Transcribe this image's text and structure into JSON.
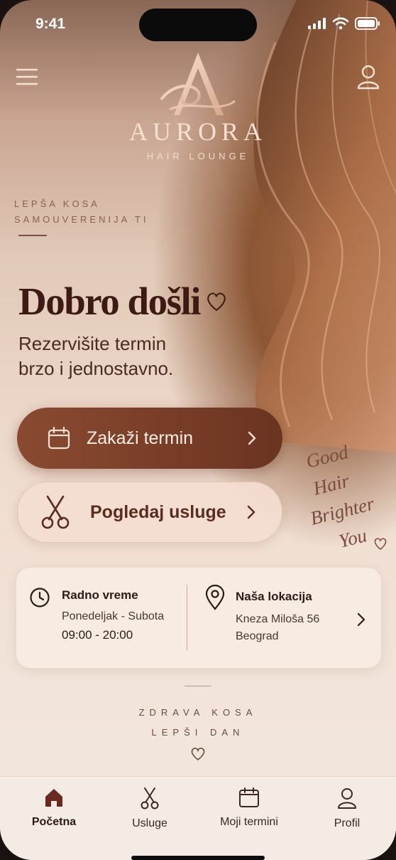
{
  "status": {
    "time": "9:41"
  },
  "brand": {
    "name": "AURORA",
    "sub": "HAIR LOUNGE"
  },
  "tagline": {
    "line1": "LEPŠA KOSA",
    "line2": "SAMOUVERENIJA TI"
  },
  "hero": {
    "title": "Dobro došli",
    "subtitle_line1": "Rezervišite termin",
    "subtitle_line2": "brzo i jednostavno."
  },
  "actions": {
    "book_label": "Zakaži termin",
    "services_label": "Pogledaj usluge"
  },
  "script_text": [
    "Good",
    "Hair",
    "Brighter",
    "You"
  ],
  "info": {
    "hours_title": "Radno vreme",
    "hours_days": "Ponedeljak - Subota",
    "hours_time": "09:00 - 20:00",
    "location_title": "Naša lokacija",
    "location_street": "Kneza Miloša 56",
    "location_city": "Beograd"
  },
  "bottom_tag": {
    "line1": "ZDRAVA KOSA",
    "line2": "LEPŠI DAN"
  },
  "tabs": [
    {
      "label": "Početna",
      "icon": "home-icon"
    },
    {
      "label": "Usluge",
      "icon": "scissors-icon"
    },
    {
      "label": "Moji termini",
      "icon": "calendar-icon"
    },
    {
      "label": "Profil",
      "icon": "user-icon"
    }
  ],
  "colors": {
    "primary": "#7a3f29",
    "dark_text": "#3d1b14",
    "accent_gold": "#e9c4ad"
  }
}
